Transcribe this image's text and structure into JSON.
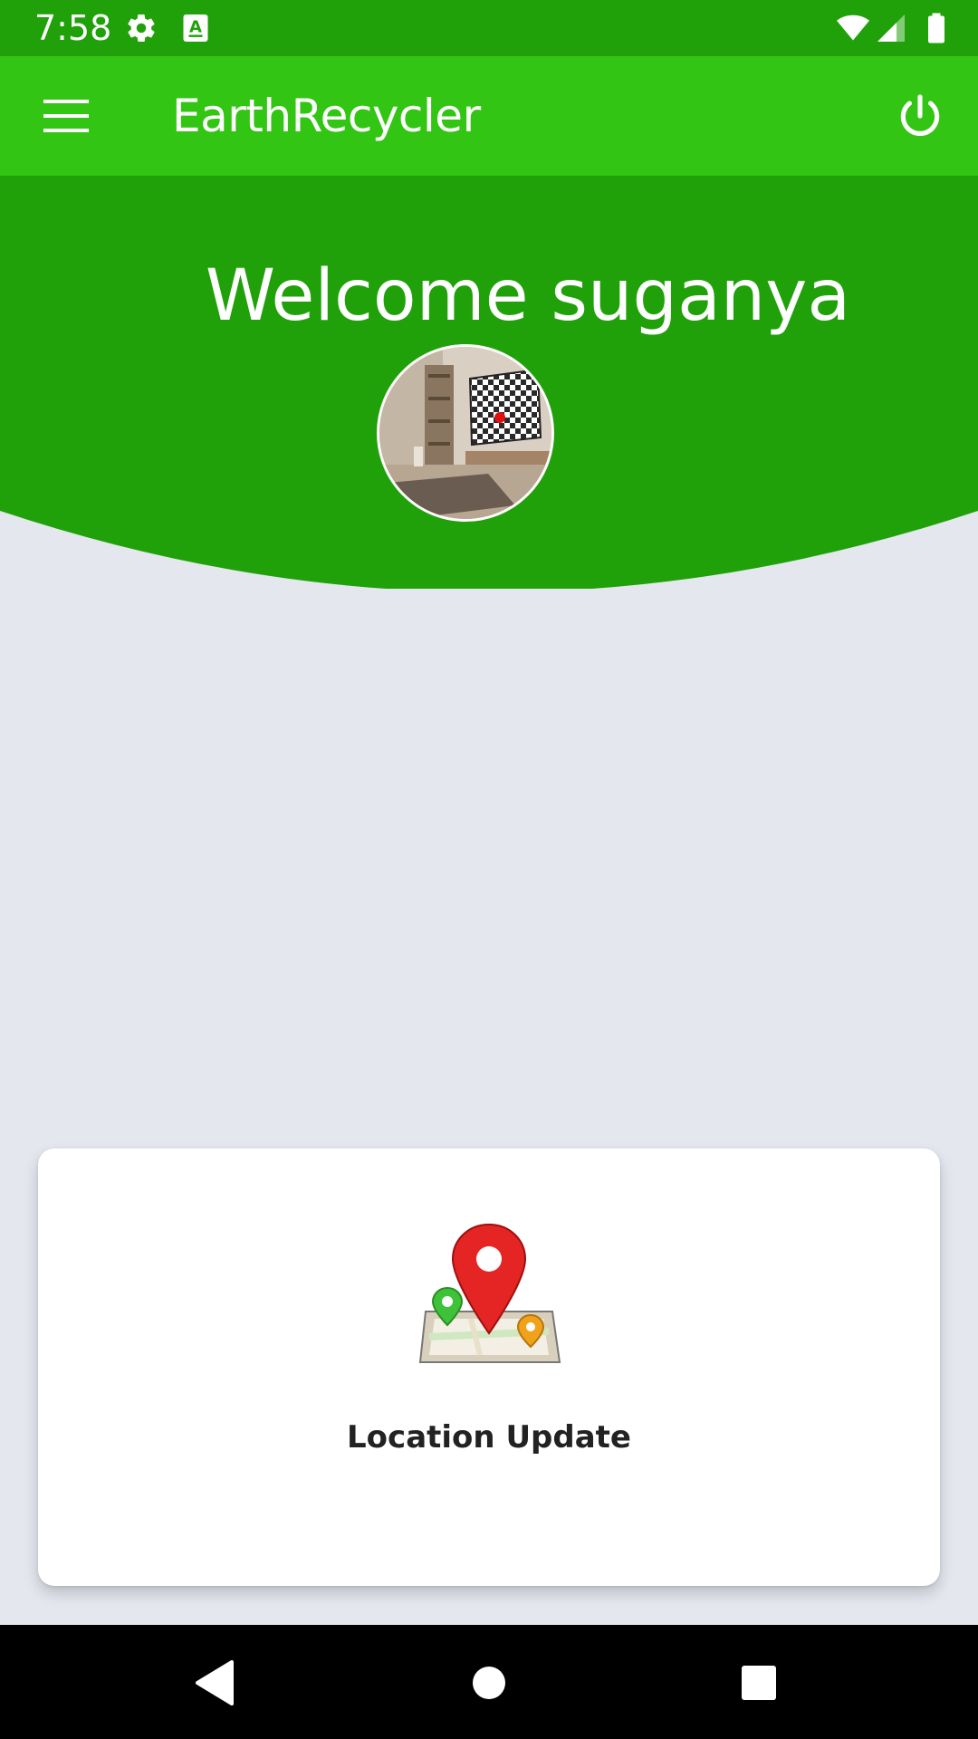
{
  "status_bar": {
    "time": "7:58",
    "icons": [
      "gear-icon",
      "text-a-icon",
      "wifi-icon",
      "cell-signal-icon",
      "battery-icon"
    ]
  },
  "app_bar": {
    "title": "EarthRecycler",
    "menu_icon": "hamburger-menu-icon",
    "power_icon": "power-icon"
  },
  "header": {
    "welcome": "Welcome suganya",
    "background_color": "#20a10a"
  },
  "card": {
    "label": "Location Update",
    "icon": "map-location-icon"
  },
  "nav_bar": {
    "icons": [
      "back-icon",
      "home-icon",
      "recents-icon"
    ]
  },
  "colors": {
    "status_bar": "#20a10a",
    "app_bar": "#33c513",
    "page_background": "#e4e8ee",
    "card_background": "#ffffff"
  }
}
